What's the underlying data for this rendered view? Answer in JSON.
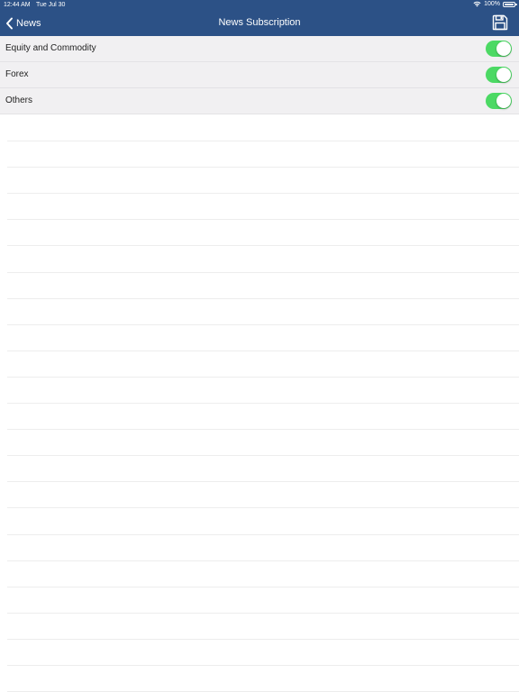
{
  "status_bar": {
    "time": "12:44 AM",
    "date": "Tue Jul 30",
    "battery": "100%"
  },
  "nav": {
    "back_label": "News",
    "title": "News Subscription",
    "back_icon": "chevron-left-icon",
    "save_icon": "floppy-disk-icon"
  },
  "subscriptions": [
    {
      "label": "Equity and Commodity",
      "enabled": true
    },
    {
      "label": "Forex",
      "enabled": true
    },
    {
      "label": "Others",
      "enabled": true
    }
  ],
  "colors": {
    "header": "#2c5186",
    "toggle_on": "#4cd964",
    "row_bg": "#f1f0f2"
  }
}
